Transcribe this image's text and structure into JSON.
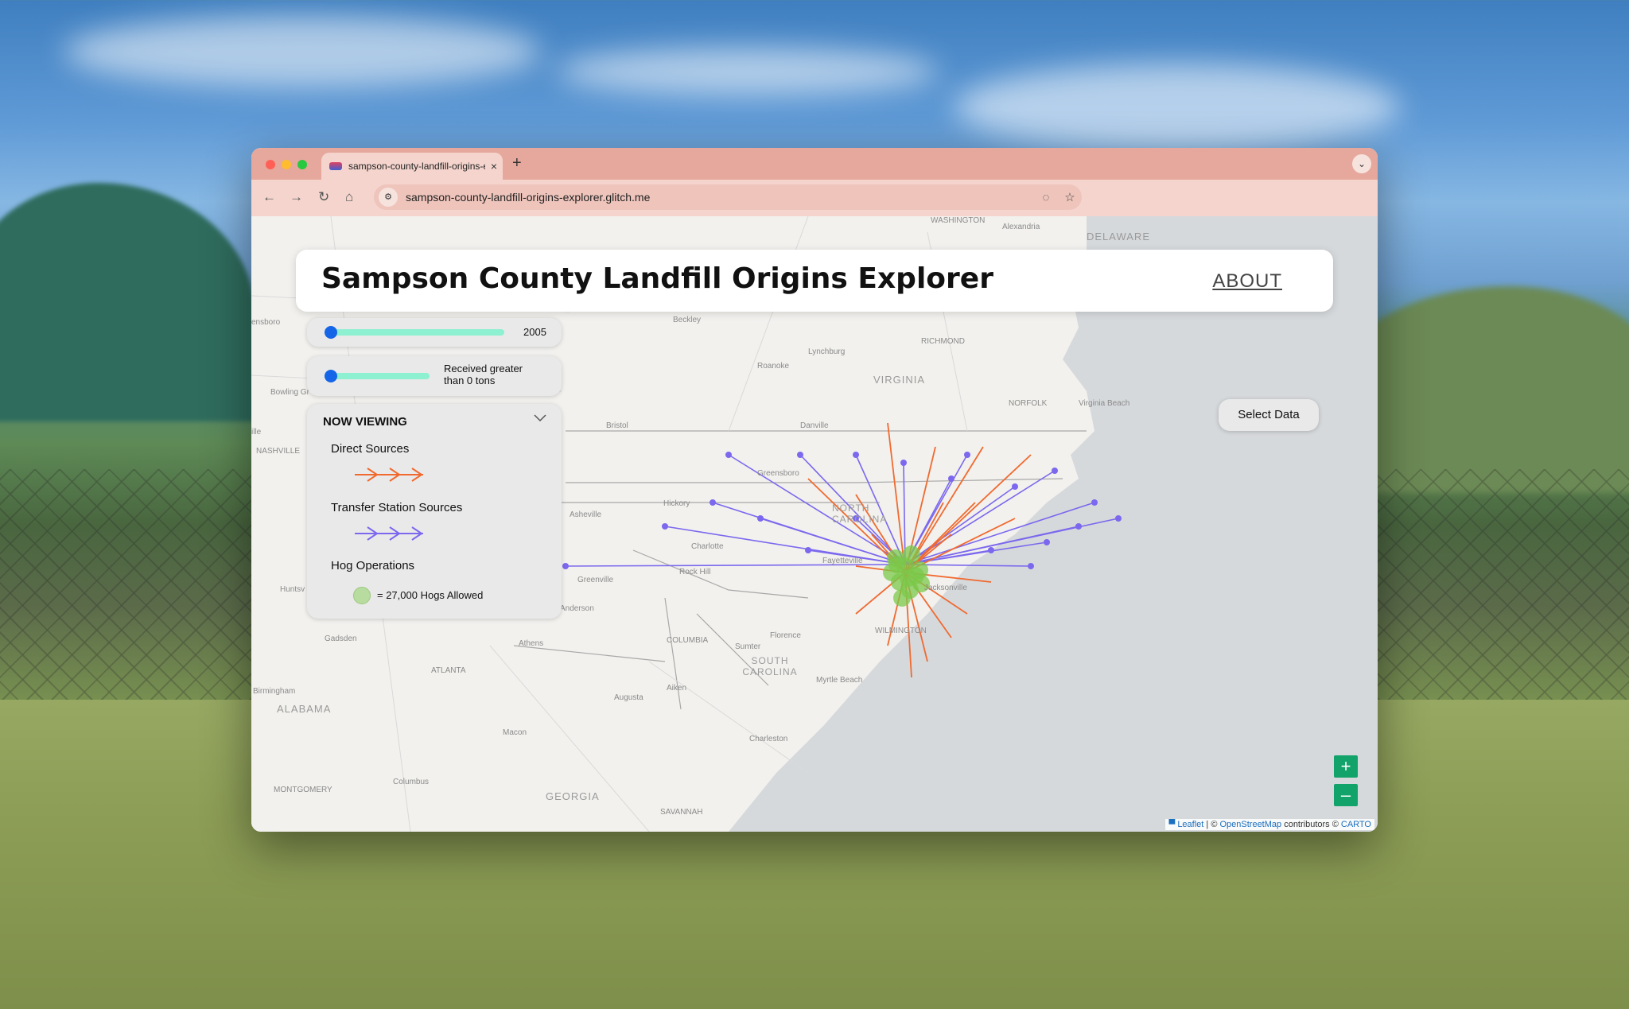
{
  "browser": {
    "tab_title": "sampson-county-landfill-origins-explorer.glitch.me",
    "url": "sampson-county-landfill-origins-explorer.glitch.me",
    "tab_close": "×",
    "new_tab": "+",
    "tab_menu": "⌄",
    "nav": {
      "back": "←",
      "forward": "→",
      "reload": "↻",
      "home": "⌂"
    },
    "url_icons": {
      "tune": "⚙",
      "eye_off": "◌",
      "star": "☆"
    }
  },
  "app": {
    "title": "Sampson County Landfill Origins Explorer",
    "about": "ABOUT",
    "select_data": "Select Data",
    "year_slider": {
      "value_label": "2005",
      "fill": 0.0
    },
    "tons_slider": {
      "label_line1": "Received greater",
      "label_line2": "than 0 tons",
      "fill": 0.0
    },
    "legend": {
      "heading": "NOW VIEWING",
      "collapse_icon": "chevron-down-icon",
      "direct": "Direct Sources",
      "transfer": "Transfer Station Sources",
      "hog": "Hog Operations",
      "hog_scale": "= 27,000 Hogs Allowed"
    },
    "zoom": {
      "in": "+",
      "out": "–"
    },
    "attribution": {
      "leaflet": "Leaflet",
      "sep1": " | © ",
      "osm": "OpenStreetMap",
      "mid": " contributors © ",
      "carto": "CARTO"
    },
    "colors": {
      "direct": "#f06a30",
      "transfer": "#7b68ee",
      "hog": "#7bc84a",
      "accent": "#12a36a",
      "slider_knob": "#1565e8",
      "slider_track": "#8df0d0"
    }
  },
  "map_labels": [
    "WASHINGTON",
    "Alexandria",
    "DELAWARE",
    "Beckley",
    "RICHMOND",
    "Lynchburg",
    "Roanoke",
    "VIRGINIA",
    "NORFOLK",
    "Virginia Beach",
    "Bowling Gr",
    "Bristol",
    "Danville",
    "NASHVILLE",
    "Greensboro",
    "Asheville",
    "Hickory",
    "NORTH CAROLINA",
    "Charlotte",
    "Greenville",
    "Rock Hill",
    "Fayetteville",
    "Jacksonville",
    "Huntsv",
    "Anderson",
    "WILMINGTON",
    "Florence",
    "Gadsden",
    "Athens",
    "COLUMBIA",
    "Sumter",
    "SOUTH CAROLINA",
    "ATLANTA",
    "Aiken",
    "Myrtle Beach",
    "Augusta",
    "Birmingham",
    "ALABAMA",
    "Macon",
    "Charleston",
    "MONTGOMERY",
    "Columbus",
    "GEORGIA",
    "SAVANNAH",
    "ensboro",
    "ille"
  ]
}
